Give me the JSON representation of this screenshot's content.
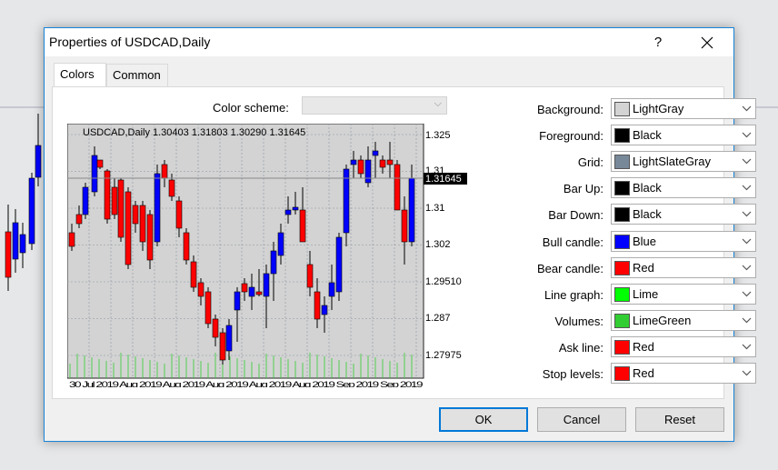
{
  "dialog": {
    "title": "Properties of USDCAD,Daily",
    "help_label": "?",
    "tabs": [
      {
        "label": "Colors",
        "active": true
      },
      {
        "label": "Common",
        "active": false
      }
    ],
    "color_scheme": {
      "label": "Color scheme:",
      "value": ""
    },
    "buttons": {
      "ok": "OK",
      "cancel": "Cancel",
      "reset": "Reset"
    }
  },
  "properties": [
    {
      "label": "Background:",
      "value": "LightGray",
      "color": "#d3d3d3"
    },
    {
      "label": "Foreground:",
      "value": "Black",
      "color": "#000000"
    },
    {
      "label": "Grid:",
      "value": "LightSlateGray",
      "color": "#778899"
    },
    {
      "label": "Bar Up:",
      "value": "Black",
      "color": "#000000"
    },
    {
      "label": "Bar Down:",
      "value": "Black",
      "color": "#000000"
    },
    {
      "label": "Bull candle:",
      "value": "Blue",
      "color": "#0000ff"
    },
    {
      "label": "Bear candle:",
      "value": "Red",
      "color": "#ff0000"
    },
    {
      "label": "Line graph:",
      "value": "Lime",
      "color": "#00ff00"
    },
    {
      "label": "Volumes:",
      "value": "LimeGreen",
      "color": "#32cd32"
    },
    {
      "label": "Ask line:",
      "value": "Red",
      "color": "#ff0000"
    },
    {
      "label": "Stop levels:",
      "value": "Red",
      "color": "#ff0000"
    }
  ],
  "preview": {
    "header": "USDCAD,Daily  1.30403 1.31803 1.30290 1.31645",
    "price_labels": [
      "1.325",
      "1.31",
      "1.31645",
      "1.31",
      "1.302",
      "1.29510",
      "1.287",
      "1.27975"
    ],
    "date_axis_text": "30 Jul 2019 Aug 2019 Aug 2019 Aug 2019 Aug 2019 Aug 2019 Sep 2019 Sep 2019"
  }
}
